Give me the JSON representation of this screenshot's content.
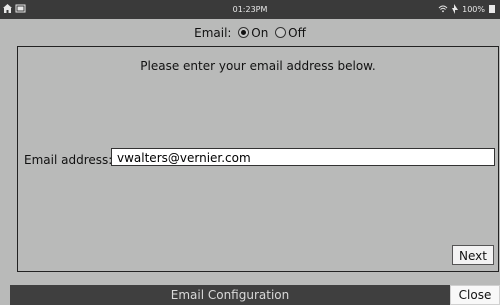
{
  "status_bar": {
    "time": "01:23PM",
    "battery": "100%",
    "icons": [
      "home-icon",
      "screen-icon",
      "wifi-icon",
      "battery-icon"
    ]
  },
  "email_toggle": {
    "label": "Email:",
    "on_label": "On",
    "off_label": "Off",
    "selected": "On"
  },
  "main": {
    "instruction": "Please enter your email address below.",
    "email_label": "Email address:",
    "email_value": "vwalters@vernier.com",
    "next_label": "Next"
  },
  "bottom_bar": {
    "title": "Email Configuration",
    "close_label": "Close"
  }
}
